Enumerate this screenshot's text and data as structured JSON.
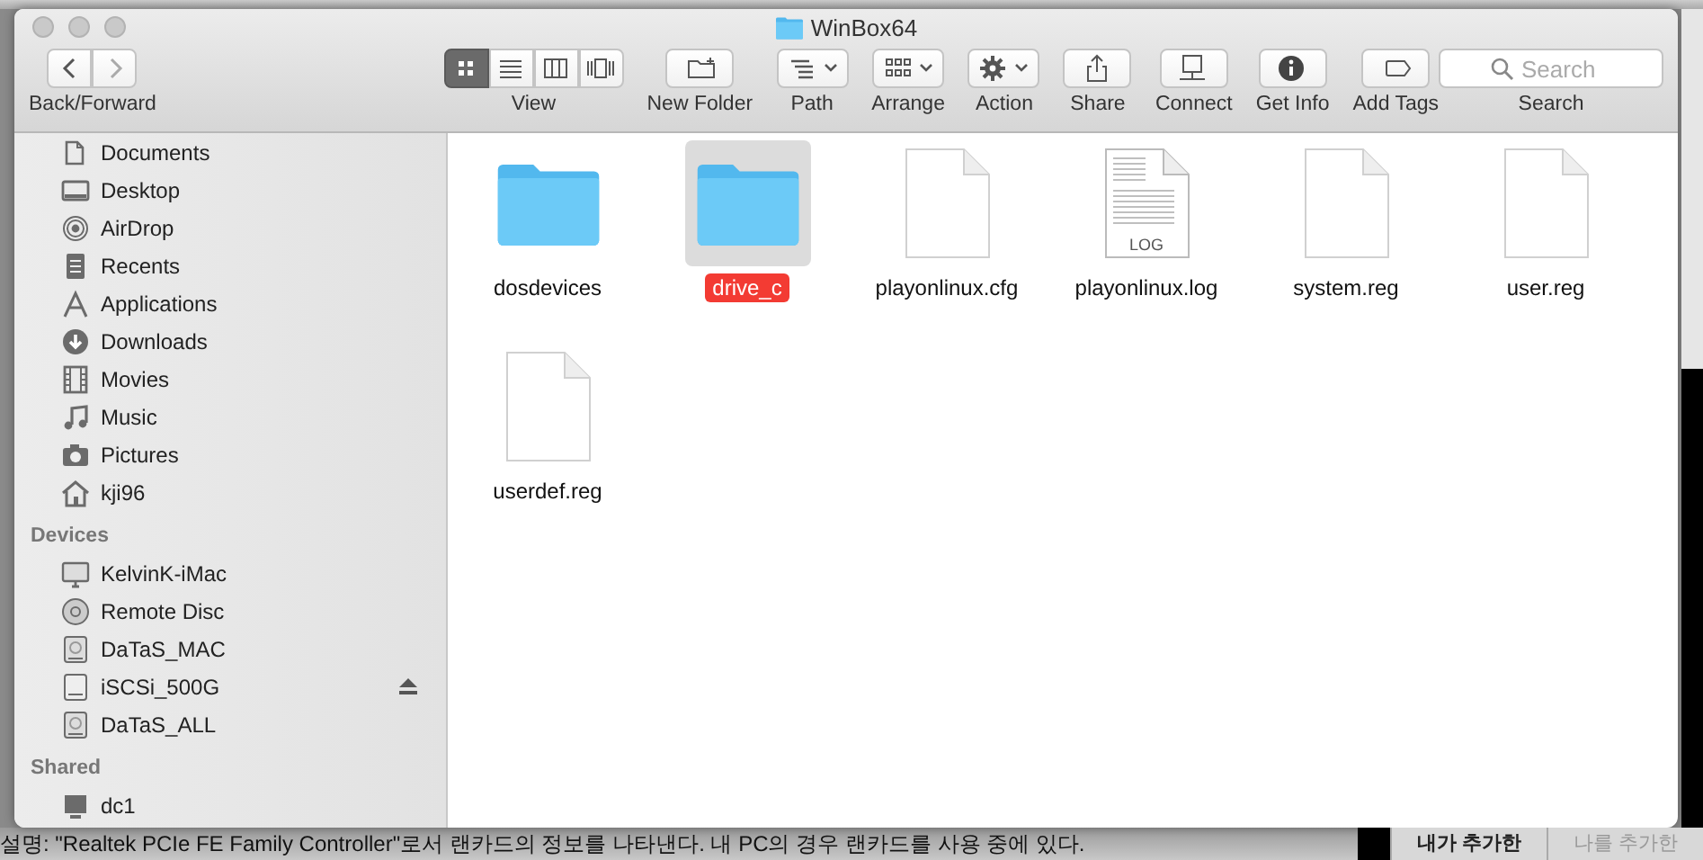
{
  "window": {
    "title": "WinBox64"
  },
  "toolbar": {
    "nav_label": "Back/Forward",
    "view_modes": [
      {
        "kind": "icons",
        "selected": true
      },
      {
        "kind": "list",
        "selected": false
      },
      {
        "kind": "columns",
        "selected": false
      },
      {
        "kind": "coverflow",
        "selected": false
      }
    ],
    "view_label": "View",
    "tools": [
      {
        "kind": "newfolder",
        "label": "New Folder"
      },
      {
        "kind": "path",
        "label": "Path"
      },
      {
        "kind": "arrange",
        "label": "Arrange"
      },
      {
        "kind": "action",
        "label": "Action"
      },
      {
        "kind": "share",
        "label": "Share"
      },
      {
        "kind": "connect",
        "label": "Connect"
      },
      {
        "kind": "info",
        "label": "Get Info"
      },
      {
        "kind": "tags",
        "label": "Add Tags"
      }
    ],
    "search": {
      "placeholder": "Search",
      "label": "Search"
    }
  },
  "sidebar": {
    "favorites": [
      {
        "kind": "documents",
        "label": "Documents"
      },
      {
        "kind": "desktop",
        "label": "Desktop"
      },
      {
        "kind": "airdrop",
        "label": "AirDrop"
      },
      {
        "kind": "recents",
        "label": "Recents"
      },
      {
        "kind": "applications",
        "label": "Applications"
      },
      {
        "kind": "downloads",
        "label": "Downloads"
      },
      {
        "kind": "movies",
        "label": "Movies"
      },
      {
        "kind": "music",
        "label": "Music"
      },
      {
        "kind": "pictures",
        "label": "Pictures"
      },
      {
        "kind": "home",
        "label": "kji96"
      }
    ],
    "sections": [
      {
        "title": "Devices",
        "items": [
          {
            "kind": "computer",
            "label": "KelvinK-iMac",
            "ejectable": false
          },
          {
            "kind": "disc",
            "label": "Remote Disc",
            "ejectable": false
          },
          {
            "kind": "drive",
            "label": "DaTaS_MAC",
            "ejectable": false
          },
          {
            "kind": "external",
            "label": "iSCSi_500G",
            "ejectable": true
          },
          {
            "kind": "drive",
            "label": "DaTaS_ALL",
            "ejectable": false
          }
        ]
      },
      {
        "title": "Shared",
        "items": [
          {
            "kind": "server",
            "label": "dc1",
            "ejectable": false
          }
        ]
      }
    ]
  },
  "files": [
    {
      "kind": "folder",
      "name": "dosdevices",
      "selected": false
    },
    {
      "kind": "folder",
      "name": "drive_c",
      "selected": true
    },
    {
      "kind": "document",
      "name": "playonlinux.cfg",
      "selected": false
    },
    {
      "kind": "log",
      "name": "playonlinux.log",
      "badge": "LOG",
      "selected": false
    },
    {
      "kind": "document",
      "name": "system.reg",
      "selected": false
    },
    {
      "kind": "document",
      "name": "user.reg",
      "selected": false
    },
    {
      "kind": "document",
      "name": "userdef.reg",
      "selected": false
    }
  ],
  "background": {
    "caption": "설명: \"Realtek PCIe FE Family Controller\"로서 랜카드의 정보를 나타낸다. 내 PC의 경우 랜카드를 사용 중에 있다.",
    "tabs": [
      {
        "label": "내가 추가한",
        "selected": true
      },
      {
        "label": "나를 추가한",
        "selected": false
      }
    ]
  }
}
